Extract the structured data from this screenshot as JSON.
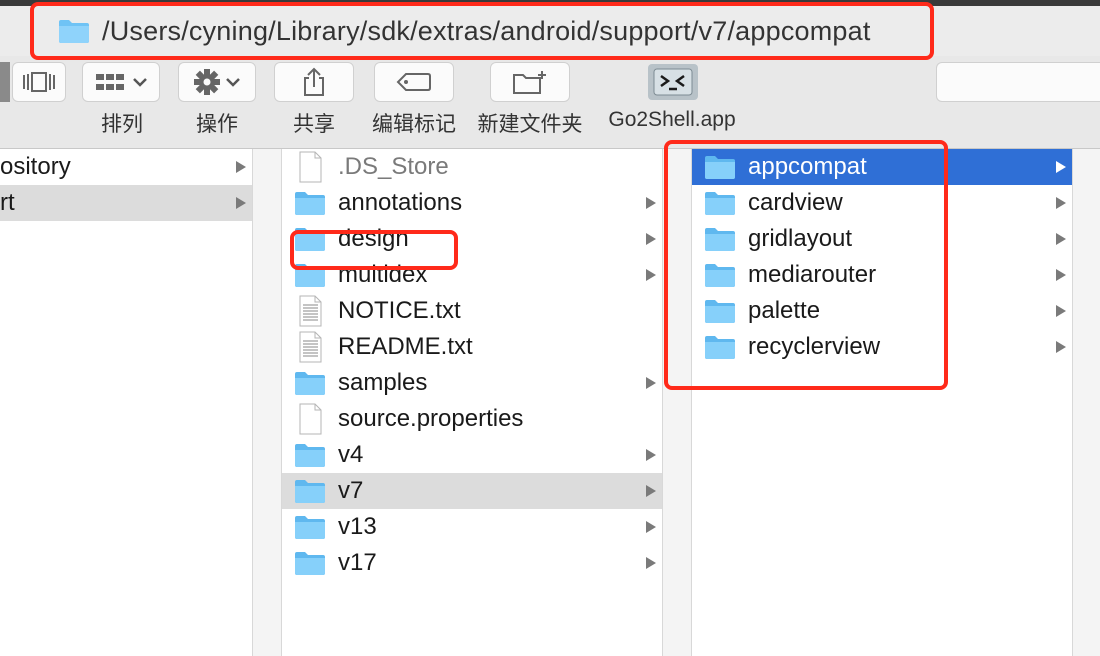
{
  "window": {
    "path": "/Users/cyning/Library/sdk/extras/android/support/v7/appcompat"
  },
  "toolbar": {
    "arrange_label": "排列",
    "action_label": "操作",
    "share_label": "共享",
    "tags_label": "编辑标记",
    "new_folder_label": "新建文件夹",
    "go2shell_label": "Go2Shell.app"
  },
  "columns": {
    "first": [
      {
        "name": "ository",
        "kind": "folder",
        "has_children": true
      },
      {
        "name": "rt",
        "kind": "folder",
        "has_children": true,
        "highlighted": true
      }
    ],
    "second": [
      {
        "name": ".DS_Store",
        "kind": "file",
        "has_children": false,
        "dimmed": true
      },
      {
        "name": "annotations",
        "kind": "folder",
        "has_children": true
      },
      {
        "name": "design",
        "kind": "folder",
        "has_children": true
      },
      {
        "name": "multidex",
        "kind": "folder",
        "has_children": true
      },
      {
        "name": "NOTICE.txt",
        "kind": "text",
        "has_children": false
      },
      {
        "name": "README.txt",
        "kind": "text",
        "has_children": false
      },
      {
        "name": "samples",
        "kind": "folder",
        "has_children": true
      },
      {
        "name": "source.properties",
        "kind": "file",
        "has_children": false
      },
      {
        "name": "v4",
        "kind": "folder",
        "has_children": true
      },
      {
        "name": "v7",
        "kind": "folder",
        "has_children": true,
        "highlighted": true
      },
      {
        "name": "v13",
        "kind": "folder",
        "has_children": true
      },
      {
        "name": "v17",
        "kind": "folder",
        "has_children": true
      }
    ],
    "third": [
      {
        "name": "appcompat",
        "kind": "folder",
        "has_children": true,
        "selected": true
      },
      {
        "name": "cardview",
        "kind": "folder",
        "has_children": true
      },
      {
        "name": "gridlayout",
        "kind": "folder",
        "has_children": true
      },
      {
        "name": "mediarouter",
        "kind": "folder",
        "has_children": true
      },
      {
        "name": "palette",
        "kind": "folder",
        "has_children": true
      },
      {
        "name": "recyclerview",
        "kind": "folder",
        "has_children": true
      }
    ]
  },
  "colors": {
    "annotation_red": "#ff2a1a",
    "selection_blue": "#2f6fd6",
    "folder_blue": "#6fc3f5"
  },
  "icons": {
    "folder": "folder-icon",
    "file": "document-icon",
    "text": "text-document-icon",
    "arrow": "disclosure-arrow-icon"
  }
}
